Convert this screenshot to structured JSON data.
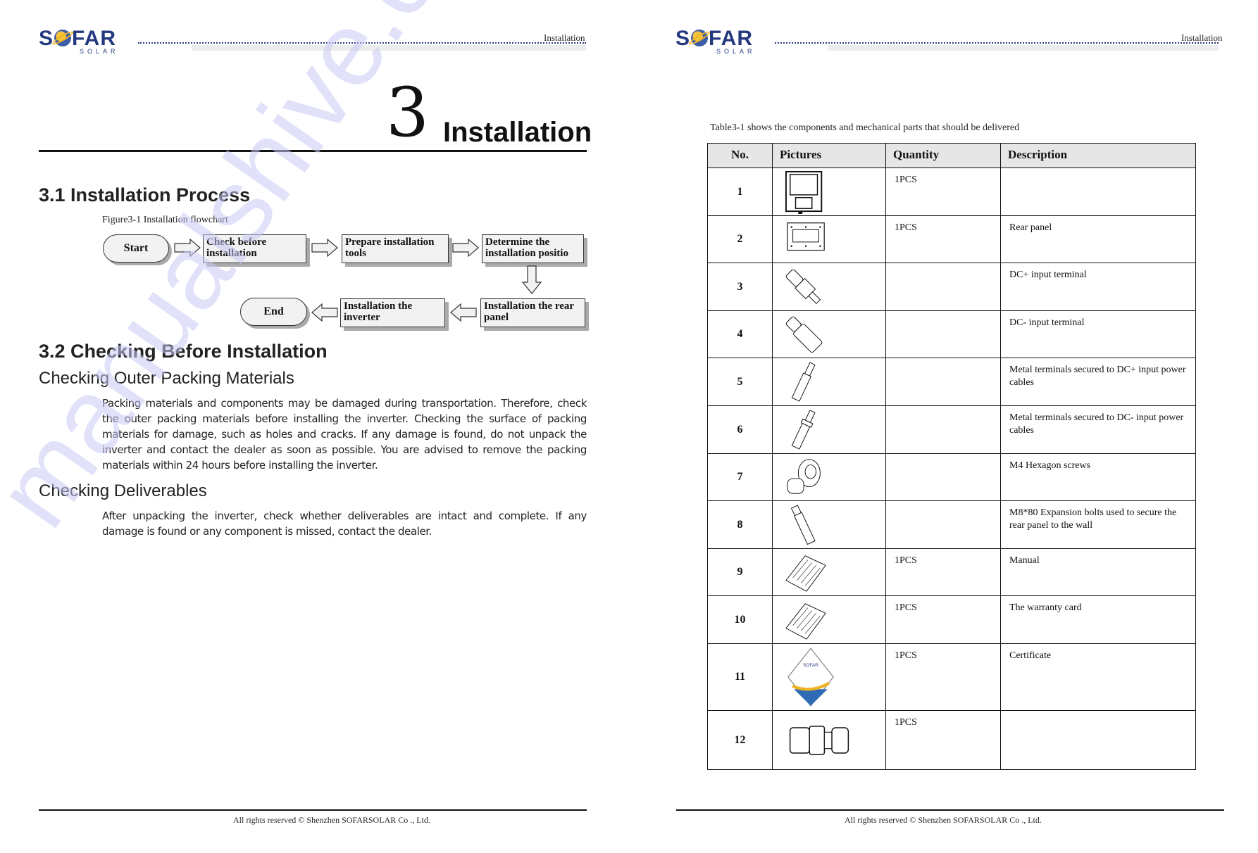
{
  "brand": {
    "name": "SOFAR",
    "tagline": "SOLAR",
    "accent_color": "#253a7e",
    "globe_color": "#f0b323"
  },
  "left_page": {
    "header_label": "Installation",
    "chapter": {
      "number": "3",
      "title": "Installation"
    },
    "section_1": {
      "heading": "3.1 Installation Process",
      "figure_caption": "Figure3-1 Installation flowchart",
      "flowchart": {
        "start": "Start",
        "steps": [
          {
            "line1": "Check before",
            "line2": "installation"
          },
          {
            "line1": "Prepare installation",
            "line2": "tools"
          },
          {
            "line1": "Determine the",
            "line2": "installation positio"
          },
          {
            "line1": "Installation the rear",
            "line2": "panel"
          },
          {
            "line1": "Installation the",
            "line2": "inverter"
          }
        ],
        "end": "End"
      }
    },
    "section_2": {
      "heading": "3.2 Checking Before Installation",
      "sub1": {
        "heading": "Checking Outer Packing Materials",
        "body": "Packing materials and components may be damaged during transportation. Therefore, check the outer packing materials before installing the inverter. Checking the surface of packing materials for damage, such as holes and cracks. If any damage is found, do not unpack the inverter and contact the dealer as soon as possible. You are advised to remove the packing materials within 24 hours before installing the inverter."
      },
      "sub2": {
        "heading": "Checking Deliverables",
        "body": "After unpacking the inverter, check whether deliverables are intact and complete. If any damage is found or any component is missed, contact the dealer."
      }
    },
    "footer": "All rights reserved © Shenzhen SOFARSOLAR Co ., Ltd."
  },
  "right_page": {
    "header_label": "Installation",
    "table_caption": "Table3-1 shows the components and mechanical parts that should be delivered",
    "table": {
      "headers": [
        "No.",
        "Pictures",
        "Quantity",
        "Description"
      ],
      "rows": [
        {
          "no": "1",
          "picture": "inverter-icon",
          "quantity": "1PCS",
          "description": ""
        },
        {
          "no": "2",
          "picture": "rear-panel-icon",
          "quantity": "1PCS",
          "description": "Rear panel"
        },
        {
          "no": "3",
          "picture": "dc-plus-terminal-icon",
          "quantity": "",
          "description": "DC+ input terminal"
        },
        {
          "no": "4",
          "picture": "dc-minus-terminal-icon",
          "quantity": "",
          "description": "DC- input terminal"
        },
        {
          "no": "5",
          "picture": "metal-terminal-plus-icon",
          "quantity": "",
          "description": "Metal terminals secured to DC+ input power cables"
        },
        {
          "no": "6",
          "picture": "metal-terminal-minus-icon",
          "quantity": "",
          "description": "Metal terminals secured to DC- input power cables"
        },
        {
          "no": "7",
          "picture": "hexagon-screw-icon",
          "quantity": "",
          "description": "M4 Hexagon screws"
        },
        {
          "no": "8",
          "picture": "expansion-bolt-icon",
          "quantity": "",
          "description": "M8*80 Expansion bolts used to secure the rear panel to the wall"
        },
        {
          "no": "9",
          "picture": "manual-icon",
          "quantity": "1PCS",
          "description": "Manual"
        },
        {
          "no": "10",
          "picture": "warranty-card-icon",
          "quantity": "1PCS",
          "description": "The warranty card"
        },
        {
          "no": "11",
          "picture": "certificate-icon",
          "quantity": "1PCS",
          "description": "Certificate"
        },
        {
          "no": "12",
          "picture": "cable-gland-icon",
          "quantity": "1PCS",
          "description": ""
        }
      ]
    },
    "footer": "All rights reserved © Shenzhen SOFARSOLAR Co ., Ltd."
  },
  "watermark": "manualshive.com"
}
